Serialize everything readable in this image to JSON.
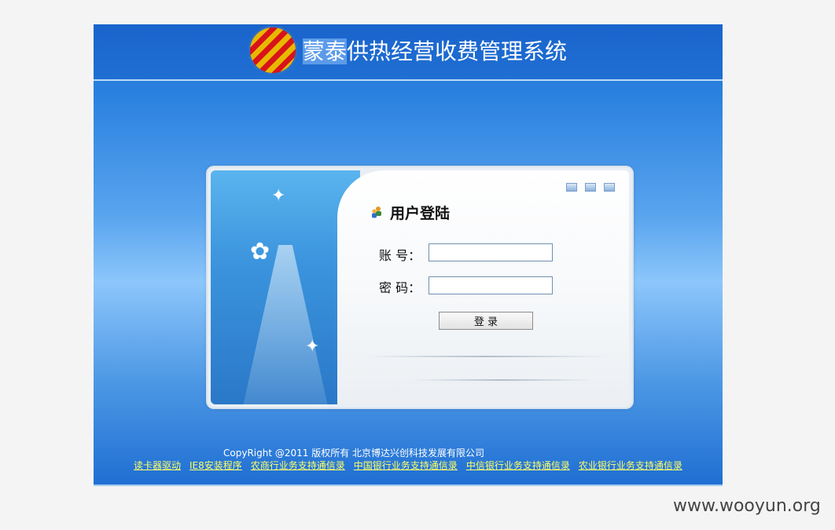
{
  "header": {
    "title_part1": "蒙泰",
    "title_part2": "供热经营收费管理系统"
  },
  "login": {
    "heading": "用户登陆",
    "account_label": "账 号：",
    "password_label": "密 码：",
    "account_value": "",
    "password_value": "",
    "submit_label": "登 录"
  },
  "footer": {
    "copyright": "CopyRight @2011 版权所有 北京博达兴创科技发展有限公司",
    "links": [
      "读卡器驱动",
      "IE8安装程序",
      "农商行业务支持通信录",
      "中国银行业务支持通信录",
      "中信银行业务支持通信录",
      "农业银行业务支持通信录"
    ]
  },
  "watermark": "www.wooyun.org",
  "colors": {
    "header_blue": "#1f6fd3",
    "link_yellow": "#ffff66"
  },
  "icons": [
    "logo-icon",
    "user-group-icon",
    "window-control-icon"
  ]
}
